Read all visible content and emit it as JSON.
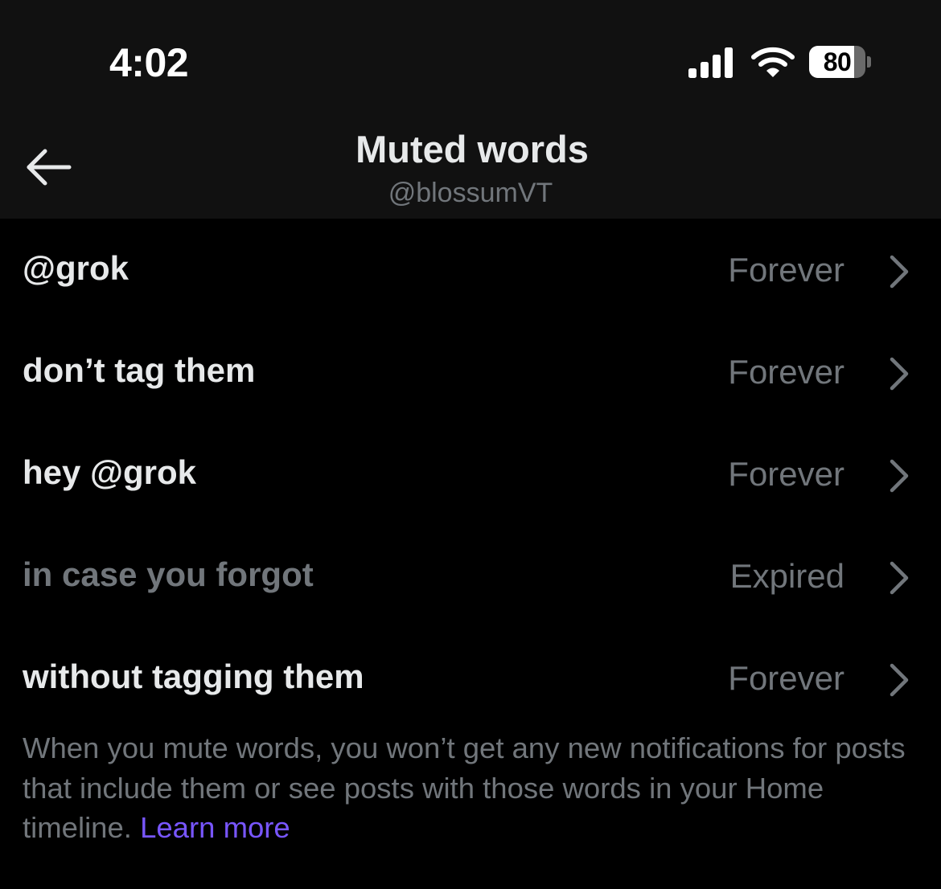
{
  "status_bar": {
    "time": "4:02",
    "battery_percent": "80",
    "battery_level": 0.8,
    "icons": [
      "cellular-signal-icon",
      "wifi-icon",
      "battery-icon"
    ]
  },
  "header": {
    "back_icon": "back-arrow-icon",
    "title": "Muted words",
    "subtitle": "@blossumVT"
  },
  "muted_words": [
    {
      "word": "@grok",
      "duration": "Forever",
      "expired": false
    },
    {
      "word": "don’t tag them",
      "duration": "Forever",
      "expired": false
    },
    {
      "word": "hey @grok",
      "duration": "Forever",
      "expired": false
    },
    {
      "word": "in case you forgot",
      "duration": "Expired",
      "expired": true
    },
    {
      "word": "without tagging them",
      "duration": "Forever",
      "expired": false
    }
  ],
  "footer": {
    "description": "When you mute words, you won’t get any new notifications for posts that include them or see posts with those words in your Home timeline.",
    "learn_more": "Learn more"
  },
  "colors": {
    "background": "#000000",
    "header_background": "#111111",
    "primary_text": "#e7e9ea",
    "secondary_text": "#71767b",
    "link": "#7856ff"
  }
}
